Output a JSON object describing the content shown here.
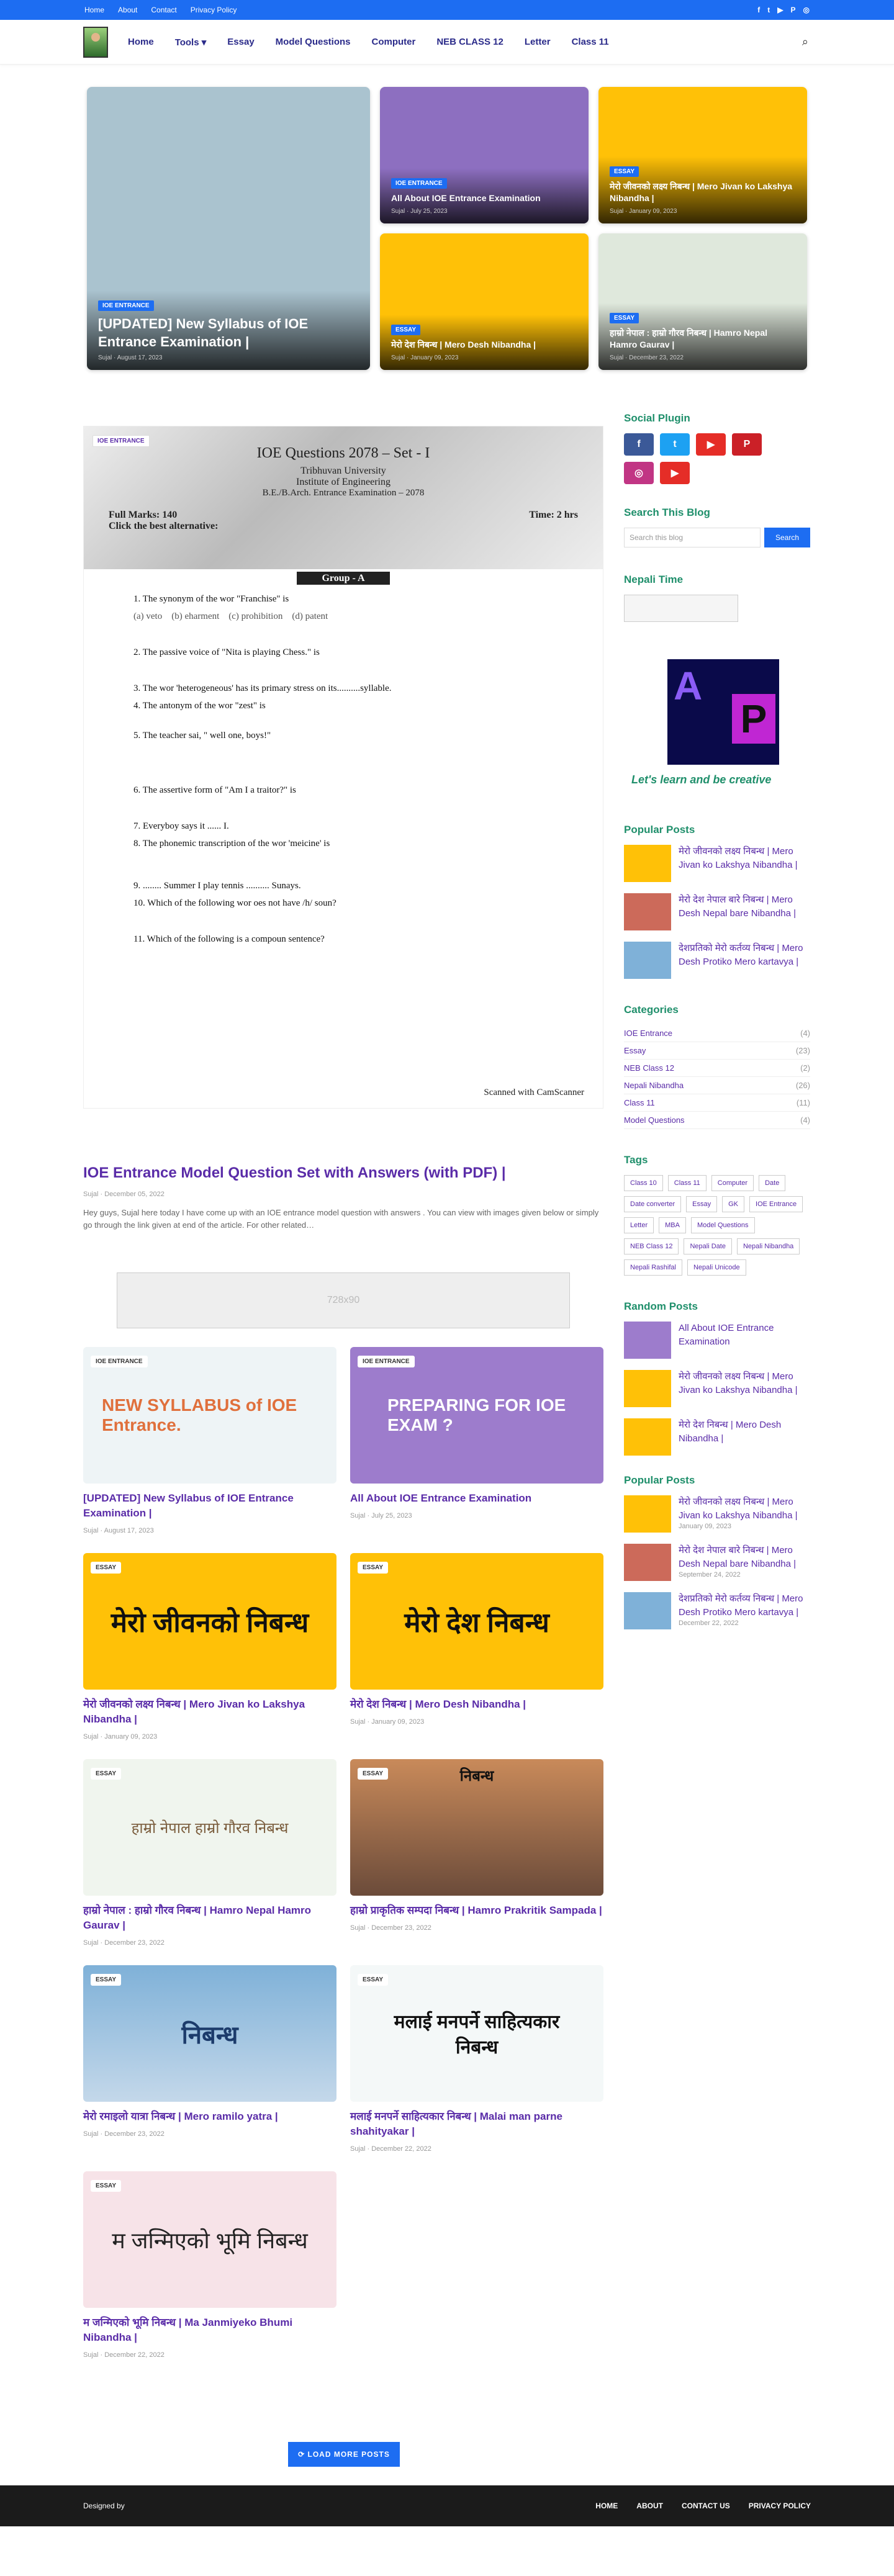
{
  "topbar": {
    "links": [
      "Home",
      "About",
      "Contact",
      "Privacy Policy"
    ],
    "social": [
      "f",
      "t",
      "▶",
      "P",
      "◎"
    ]
  },
  "nav": {
    "items": [
      "Home",
      "Tools ▾",
      "Essay",
      "Model Questions",
      "Computer",
      "NEB CLASS 12",
      "Letter",
      "Class 11"
    ]
  },
  "hero": [
    {
      "badge": "IOE ENTRANCE",
      "title": "[UPDATED] New Syllabus of IOE Entrance Examination |",
      "meta": "Sujal · August 17, 2023"
    },
    {
      "badge": "IOE ENTRANCE",
      "title": "All About IOE Entrance Examination",
      "meta": "Sujal · July 25, 2023"
    },
    {
      "badge": "ESSAY",
      "title": "मेरो जीवनको लक्ष्य निबन्ध | Mero Jivan ko Lakshya Nibandha |",
      "meta": "Sujal · January 09, 2023"
    },
    {
      "badge": "ESSAY",
      "title": "मेरो देश निबन्ध | Mero Desh Nibandha |",
      "meta": "Sujal · January 09, 2023"
    },
    {
      "badge": "ESSAY",
      "title": "हाम्रो नेपाल : हाम्रो गौरव निबन्ध | Hamro Nepal Hamro Gaurav |",
      "meta": "Sujal · December 23, 2022"
    }
  ],
  "featured": {
    "badge": "IOE ENTRANCE",
    "title": "IOE Entrance Model Question Set with Answers (with PDF) |",
    "meta": "Sujal · December 05, 2022",
    "excerpt": "Hey guys, Sujal here today I have come up with an IOE entrance model question with answers . You can view with images given below or simply go through the link given at end of the article.  For other related…",
    "paper_title": "IOE Questions 2078 – Set - I",
    "paper_sub": [
      "Tribhuvan University",
      "Institute of Engineering",
      "B.E./B.Arch. Entrance Examination – 2078"
    ],
    "paper_marks": "Full Marks: 140",
    "paper_time": "Time: 2 hrs",
    "paper_instr": "Click the best alternative:",
    "paper_group": "Group - A",
    "questions": [
      "1. The synonym of the wor \"Franchise\" is",
      "2. The passive voice of \"Nita is playing Chess.\" is",
      "3. The wor 'heterogeneous' has its primary stress on its..........syllable.",
      "4. The antonym of the wor \"zest\" is",
      "5. The teacher sai, \" well one, boys!\"",
      "6. The assertive form of \"Am I a traitor?\" is",
      "7. Everyboy says it ...... I.",
      "8. The phonemic transcription of the wor 'meicine' is",
      "9. ........ Summer I play tennis .......... Sunays.",
      "10. Which of the following wor oes not have /h/ soun?",
      "11. Which of the following is a compoun sentence?"
    ],
    "scanned": "Scanned with CamScanner"
  },
  "ad": "728x90",
  "posts": [
    {
      "badge": "IOE ENTRANCE",
      "thumb": "NEW SYLLABUS of IOE Entrance.",
      "title": "[UPDATED] New Syllabus of IOE Entrance Examination |",
      "meta": "Sujal · August 17, 2023",
      "color": "#eef4f6"
    },
    {
      "badge": "IOE ENTRANCE",
      "thumb": "PREPARING FOR IOE EXAM ?",
      "title": "All About IOE Entrance Examination",
      "meta": "Sujal · July 25, 2023",
      "color": "#9d7ccc"
    },
    {
      "badge": "ESSAY",
      "thumb": "मेरो जीवनको निबन्ध",
      "title": "मेरो जीवनको लक्ष्य निबन्ध | Mero Jivan ko Lakshya Nibandha |",
      "meta": "Sujal · January 09, 2023",
      "color": "#ffc107"
    },
    {
      "badge": "ESSAY",
      "thumb": "मेरो देश निबन्ध",
      "title": "मेरो देश निबन्ध | Mero Desh Nibandha |",
      "meta": "Sujal · January 09, 2023",
      "color": "#ffc107"
    },
    {
      "badge": "ESSAY",
      "thumb": "हाम्रो नेपाल हाम्रो गौरव निबन्ध",
      "title": "हाम्रो नेपाल : हाम्रो गौरव निबन्ध | Hamro Nepal Hamro Gaurav |",
      "meta": "Sujal · December 23, 2022",
      "color": "#f0f5ee"
    },
    {
      "badge": "ESSAY",
      "thumb": "निबन्ध",
      "title": "हाम्रो प्राकृतिक सम्पदा निबन्ध | Hamro Prakritik Sampada |",
      "meta": "Sujal · December 23, 2022",
      "color": "#c98a5a"
    },
    {
      "badge": "ESSAY",
      "thumb": "निबन्ध",
      "title": "मेरो रमाइलो यात्रा निबन्ध | Mero ramilo yatra |",
      "meta": "Sujal · December 23, 2022",
      "color": "#7fb1d8"
    },
    {
      "badge": "ESSAY",
      "thumb": "मलाई मनपर्ने साहित्यकार निबन्ध",
      "title": "मलाई मनपर्ने साहित्यकार निबन्ध | Malai man parne shahityakar |",
      "meta": "Sujal · December 22, 2022",
      "color": "#f4f8f8"
    },
    {
      "badge": "ESSAY",
      "thumb": "म जन्मिएको भूमि निबन्ध",
      "title": "म जन्मिएको भूमि निबन्ध | Ma Janmiyeko Bhumi Nibandha |",
      "meta": "Sujal · December 22, 2022",
      "color": "#f7e3e8"
    }
  ],
  "load": "⟳ LOAD MORE POSTS",
  "sidebar": {
    "social_h": "Social Plugin",
    "search_h": "Search This Blog",
    "search_ph": "Search this blog",
    "search_btn": "Search",
    "time_h": "Nepali Time",
    "tagline": "Let's learn and be creative",
    "popular_h": "Popular Posts",
    "popular": [
      "मेरो जीवनको लक्ष्य निबन्ध | Mero Jivan ko Lakshya Nibandha |",
      "मेरो देश नेपाल बारे निबन्ध | Mero Desh Nepal bare Nibandha |",
      "देशप्रतिको मेरो कर्तव्य निबन्ध | Mero Desh Protiko Mero kartavya |"
    ],
    "cat_h": "Categories",
    "cats": [
      [
        "IOE Entrance",
        "(4)"
      ],
      [
        "Essay",
        "(23)"
      ],
      [
        "NEB Class 12",
        "(2)"
      ],
      [
        "Nepali Nibandha",
        "(26)"
      ],
      [
        "Class 11",
        "(11)"
      ],
      [
        "Model Questions",
        "(4)"
      ]
    ],
    "tags_h": "Tags",
    "tags": [
      "Class 10",
      "Class 11",
      "Computer",
      "Date",
      "Date converter",
      "Essay",
      "GK",
      "IOE Entrance",
      "Letter",
      "MBA",
      "Model Questions",
      "NEB Class 12",
      "Nepali Date",
      "Nepali Nibandha",
      "Nepali Rashifal",
      "Nepali Unicode"
    ],
    "random_h": "Random Posts",
    "random": [
      "All About IOE Entrance Examination",
      "मेरो जीवनको लक्ष्य निबन्ध | Mero Jivan ko Lakshya Nibandha |",
      "मेरो देश निबन्ध | Mero Desh Nibandha |"
    ],
    "popular2_h": "Popular Posts",
    "popular2": [
      [
        "मेरो जीवनको लक्ष्य निबन्ध | Mero Jivan ko Lakshya Nibandha |",
        "January 09, 2023"
      ],
      [
        "मेरो देश नेपाल बारे निबन्ध | Mero Desh Nepal bare Nibandha |",
        "September 24, 2022"
      ],
      [
        "देशप्रतिको मेरो कर्तव्य निबन्ध | Mero Desh Protiko Mero kartavya |",
        "December 22, 2022"
      ]
    ]
  },
  "footer": {
    "credit": "Designed by",
    "links": [
      "HOME",
      "ABOUT",
      "CONTACT US",
      "PRIVACY POLICY"
    ]
  }
}
